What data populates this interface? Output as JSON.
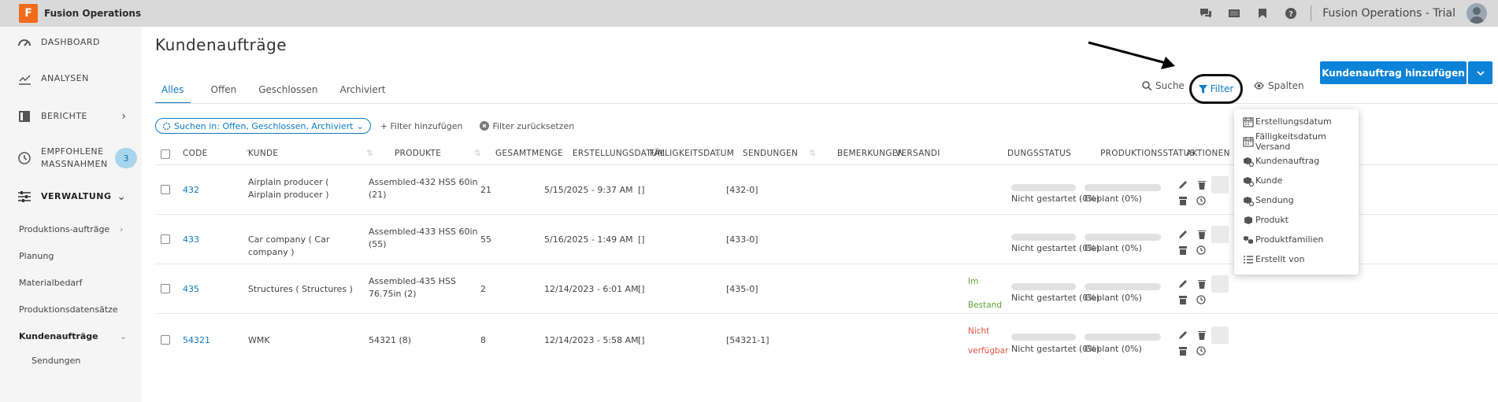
{
  "app": {
    "name": "Fusion Operations",
    "logo_letter": "F",
    "user_label": "Fusion Operations - Trial"
  },
  "sidebar": {
    "items": [
      {
        "label": "DASHBOARD"
      },
      {
        "label": "ANALYSEN"
      },
      {
        "label": "BERICHTE"
      },
      {
        "label": "EMPFOHLENE MASSNAHMEN",
        "badge": "3"
      },
      {
        "label": "VERWALTUNG"
      }
    ],
    "sub_items": [
      {
        "label": "Produktions-aufträge"
      },
      {
        "label": "Planung"
      },
      {
        "label": "Materialbedarf"
      },
      {
        "label": "Produktionsdatensätze"
      },
      {
        "label": "Kundenaufträge"
      },
      {
        "label": "Sendungen"
      }
    ]
  },
  "page": {
    "title": "Kundenaufträge"
  },
  "tabs": [
    {
      "label": "Alles"
    },
    {
      "label": "Offen"
    },
    {
      "label": "Geschlossen"
    },
    {
      "label": "Archiviert"
    }
  ],
  "toolbar": {
    "search_label": "Suche",
    "filter_label": "Filter",
    "columns_label": "Spalten",
    "add_label": "Kundenauftrag hinzufügen"
  },
  "filters": {
    "search_in": "Suchen in: Offen, Geschlossen, Archiviert",
    "add_filter": "+ Filter hinzufügen",
    "reset_filter": "Filter zurücksetzen"
  },
  "table": {
    "columns": {
      "code": "CODE",
      "customer": "KUNDE",
      "products": "PRODUKTE",
      "total": "GESAMTMENGE",
      "created": "ERSTELLUNGSDATUM",
      "due": "FÄLLIGKEITSDATUM",
      "shipments": "SENDUNGEN",
      "remarks": "BEMERKUNGEN",
      "shipping": "VERSANDI",
      "status": "DUNGSSTATUS",
      "production": "PRODUKTIONSSTATUS",
      "actions": "AKTIONEN"
    },
    "rows": [
      {
        "code": "432",
        "customer": "Airplain producer ( Airplain producer )",
        "products": "Assembled-432 HSS 60in (21)",
        "total": "21",
        "created": "5/15/2025 - 9:37 AM",
        "due": "[]",
        "shipments": "[432-0]",
        "stock_a": "",
        "stock_b": "",
        "status": "Nicht gestartet (0%)",
        "production": "Geplant (0%)"
      },
      {
        "code": "433",
        "customer": "Car company ( Car company )",
        "products": "Assembled-433 HSS 60in (55)",
        "total": "55",
        "created": "5/16/2025 - 1:49 AM",
        "due": "[]",
        "shipments": "[433-0]",
        "stock_a": "",
        "stock_b": "",
        "status": "Nicht gestartet (0%)",
        "production": "Geplant (0%)"
      },
      {
        "code": "435",
        "customer": "Structures ( Structures )",
        "products": "Assembled-435 HSS 76.75in (2)",
        "total": "2",
        "created": "12/14/2023 - 6:01 AM",
        "due": "[]",
        "shipments": "[435-0]",
        "stock_a": "Im",
        "stock_b": "Bestand",
        "status": "Nicht gestartet (0%)",
        "production": "Geplant (0%)"
      },
      {
        "code": "54321",
        "customer": "WMK",
        "products": "54321 (8)",
        "total": "8",
        "created": "12/14/2023 - 5:58 AM",
        "due": "[]",
        "shipments": "[54321-1]",
        "stock_a": "Nicht",
        "stock_b": "verfügbar",
        "status": "Nicht gestartet (0%)",
        "production": "Geplant (0%)"
      }
    ]
  },
  "filter_menu": {
    "items": [
      {
        "label": "Erstellungsdatum",
        "icon": "calendar-icon"
      },
      {
        "label": "Fälligkeitsdatum Versand",
        "icon": "calendar-icon"
      },
      {
        "label": "Kundenauftrag",
        "icon": "box-link-icon"
      },
      {
        "label": "Kunde",
        "icon": "box-link-icon"
      },
      {
        "label": "Sendung",
        "icon": "box-link-icon"
      },
      {
        "label": "Produkt",
        "icon": "box-icon"
      },
      {
        "label": "Produktfamilien",
        "icon": "boxes-icon"
      },
      {
        "label": "Erstellt von",
        "icon": "list-icon"
      }
    ]
  },
  "colors": {
    "accent": "#0d83d8",
    "logo": "#f26a1b",
    "in_stock": "#5aa832",
    "unavailable": "#e0523c"
  }
}
